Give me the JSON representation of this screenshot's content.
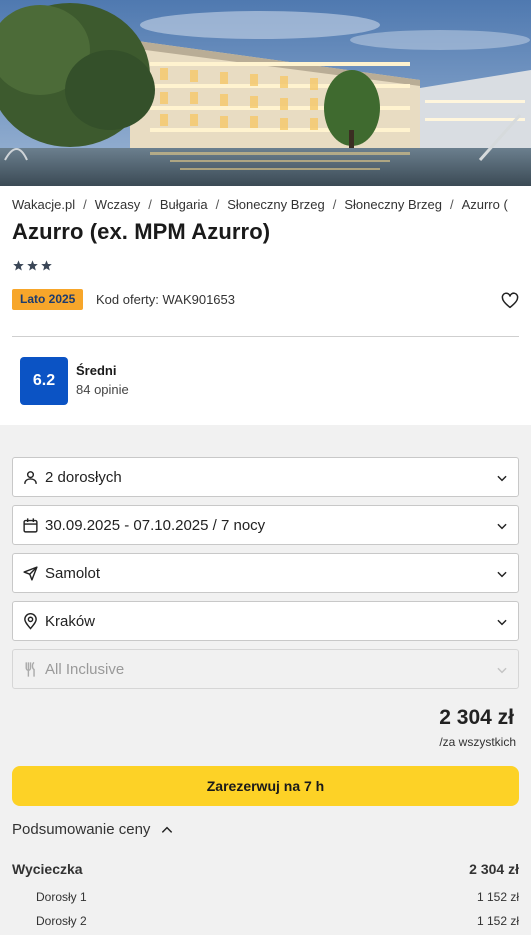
{
  "hero": {
    "alt_icon": "hotel-photo"
  },
  "breadcrumb": [
    "Wakacje.pl",
    "Wczasy",
    "Bułgaria",
    "Słoneczny Brzeg",
    "Słoneczny Brzeg",
    "Azurro ("
  ],
  "breadcrumb_separator": "/",
  "hotel": {
    "name": "Azurro (ex. MPM Azurro)",
    "stars": 3,
    "season_badge": "Lato 2025",
    "offer_code": "Kod oferty: WAK901653"
  },
  "rating": {
    "score": "6.2",
    "label": "Średni",
    "count": "84 opinie"
  },
  "filters": {
    "guests": {
      "value": "2 dorosłych",
      "icon": "person-icon"
    },
    "dates": {
      "value": "30.09.2025 - 07.10.2025 / 7 nocy",
      "icon": "calendar-icon"
    },
    "transport": {
      "value": "Samolot",
      "icon": "plane-icon"
    },
    "departure": {
      "value": "Kraków",
      "icon": "location-pin-icon"
    },
    "board": {
      "value": "All Inclusive",
      "icon": "cutlery-icon",
      "disabled": true
    }
  },
  "pricing": {
    "total": "2 304 zł",
    "per": "/za wszystkich",
    "book_label": "Zarezerwuj na 7 h",
    "summary_label": "Podsumowanie ceny",
    "trip_label": "Wycieczka",
    "trip_value": "2 304 zł",
    "rows": [
      {
        "label": "Dorosły 1",
        "value": "1 152 zł"
      },
      {
        "label": "Dorosły 2",
        "value": "1 152 zł"
      }
    ]
  },
  "colors": {
    "badge_bg": "#f7a62a",
    "rating_bg": "#0b53c4",
    "book_button": "#fdd226",
    "panel_bg": "#f1f1f1"
  }
}
